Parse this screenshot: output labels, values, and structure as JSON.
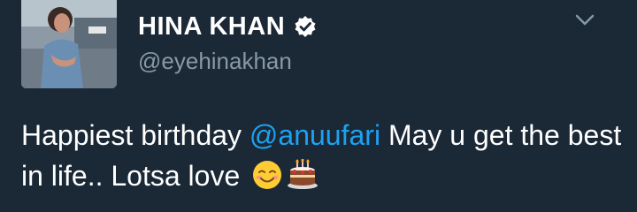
{
  "tweet": {
    "display_name": "HINA KHAN",
    "handle": "@eyehinakhan",
    "verified": true,
    "text_before": "Happiest birthday ",
    "mention": "@anuufari",
    "text_after": " May u get the best in life.. Lotsa love ",
    "emojis": [
      "smiling-face-emoji",
      "birthday-cake-emoji"
    ]
  },
  "colors": {
    "background": "#1b2836",
    "text": "#ffffff",
    "secondary_text": "#8899a6",
    "link": "#1da1f2"
  }
}
